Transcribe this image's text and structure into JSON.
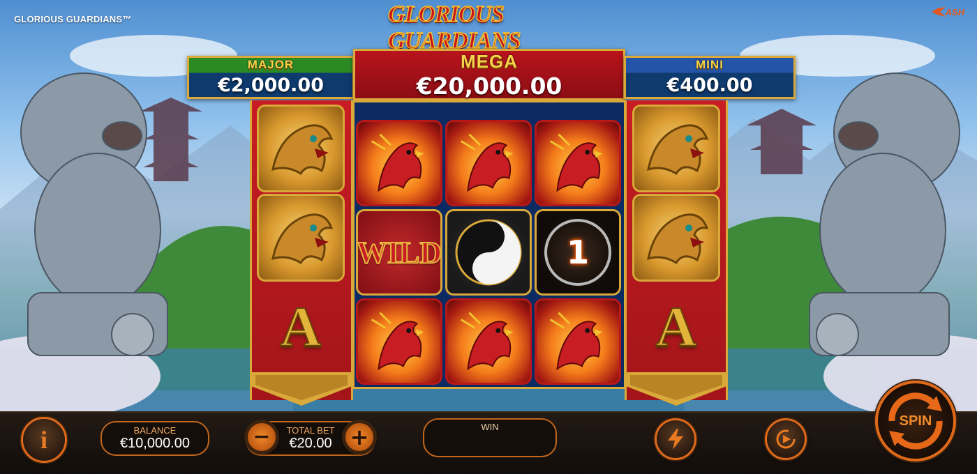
{
  "game_name": "GLORIOUS GUARDIANS™",
  "logo_title": "GLORIOUS GUARDIANS",
  "brand": "ASH",
  "jackpots": {
    "major": {
      "label": "MAJOR",
      "value": "€2,000.00"
    },
    "mega": {
      "label": "MEGA",
      "value": "€20,000.00"
    },
    "mini": {
      "label": "MINI",
      "value": "€400.00"
    }
  },
  "reels": {
    "left_banner": [
      "dragon",
      "dragon",
      "A"
    ],
    "center": [
      [
        "phoenix",
        "phoenix",
        "phoenix"
      ],
      [
        "wild",
        "yin-yang",
        "coin"
      ],
      [
        "phoenix",
        "phoenix",
        "phoenix"
      ]
    ],
    "right_banner": [
      "dragon",
      "dragon",
      "A"
    ],
    "wild_label": "WILD",
    "coin_value": "1",
    "a_letter": "A"
  },
  "controls": {
    "info_icon": "i",
    "balance_label": "BALANCE",
    "balance_value": "€10,000.00",
    "bet_label": "TOTAL BET",
    "bet_value": "€20.00",
    "minus": "−",
    "plus": "+",
    "win_label": "WIN",
    "win_value": "",
    "turbo_icon": "lightning-icon",
    "autoplay_icon": "autoplay-icon",
    "spin_label": "SPIN"
  },
  "colors": {
    "accent": "#e06a1a",
    "gold": "#d9a93a",
    "mega_red": "#b8141c",
    "major_green": "#2c8a25",
    "mini_blue": "#2454a8"
  }
}
